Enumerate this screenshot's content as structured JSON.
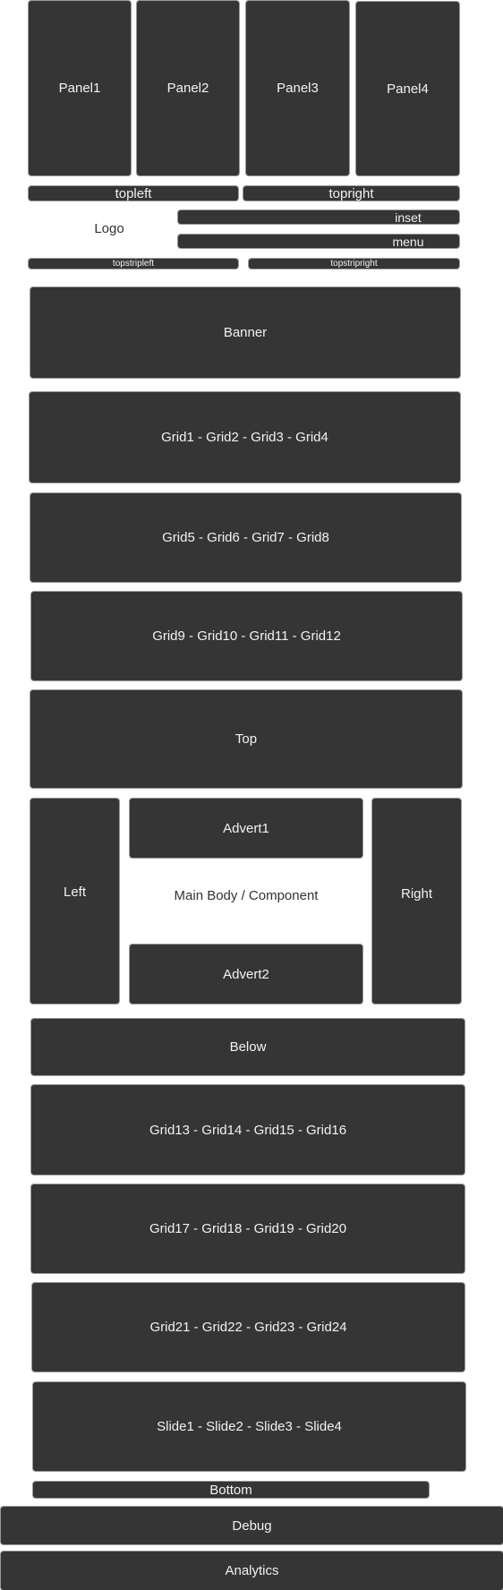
{
  "panels": [
    "Panel1",
    "Panel2",
    "Panel3",
    "Panel4"
  ],
  "topleft": "topleft",
  "topright": "topright",
  "logo": "Logo",
  "inset": "inset",
  "menu": "menu",
  "topstripleft": "topstripleft",
  "topstripright": "topstripright",
  "banner": "Banner",
  "grids": [
    "Grid1 - Grid2 - Grid3 - Grid4",
    "Grid5 - Grid6 - Grid7 - Grid8",
    "Grid9 - Grid10 - Grid11 - Grid12"
  ],
  "top": "Top",
  "left": "Left",
  "advert1": "Advert1",
  "main_body": "Main Body / Component",
  "advert2": "Advert2",
  "right": "Right",
  "below": "Below",
  "grids2": [
    "Grid13 - Grid14 - Grid15 - Grid16",
    "Grid17 - Grid18 - Grid19 - Grid20",
    "Grid21 - Grid22 - Grid23 - Grid24"
  ],
  "slides": "Slide1 - Slide2 - Slide3 - Slide4",
  "bottom": "Bottom",
  "debug": "Debug",
  "analytics": "Analytics"
}
